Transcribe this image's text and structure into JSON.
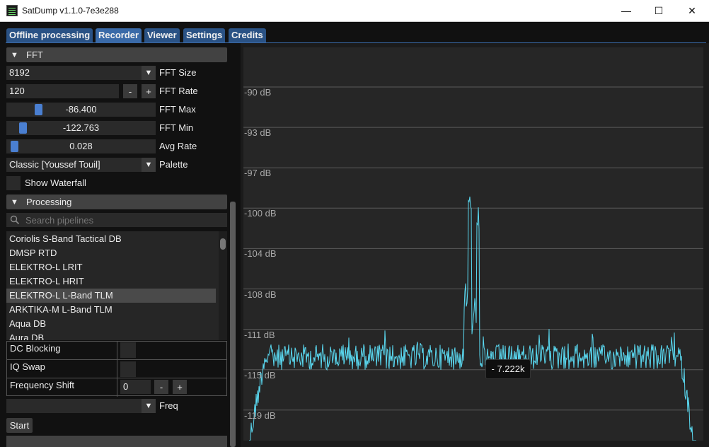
{
  "window": {
    "title": "SatDump v1.1.0-7e3e288",
    "controls": {
      "minimize": "—",
      "maximize": "☐",
      "close": "✕"
    }
  },
  "tabs": [
    {
      "label": "Offline processing",
      "active": false
    },
    {
      "label": "Recorder",
      "active": true
    },
    {
      "label": "Viewer",
      "active": false
    },
    {
      "label": "Settings",
      "active": false
    },
    {
      "label": "Credits",
      "active": false
    }
  ],
  "fft": {
    "header": "FFT",
    "size": {
      "value": "8192",
      "label": "FFT Size"
    },
    "rate": {
      "value": "120",
      "label": "FFT Rate",
      "minus": "-",
      "plus": "+"
    },
    "max": {
      "value": "-86.400",
      "label": "FFT Max",
      "position": 0.2
    },
    "min": {
      "value": "-122.763",
      "label": "FFT Min",
      "position": 0.09
    },
    "avg": {
      "value": "0.028",
      "label": "Avg Rate",
      "position": 0.03
    },
    "palette": {
      "value": "Classic [Youssef Touil]",
      "label": "Palette"
    },
    "waterfall": {
      "label": "Show Waterfall",
      "checked": false
    }
  },
  "processing": {
    "header": "Processing",
    "search_placeholder": "Search pipelines",
    "pipelines": [
      {
        "name": "Coriolis S-Band Tactical DB",
        "selected": false
      },
      {
        "name": "DMSP RTD",
        "selected": false
      },
      {
        "name": "ELEKTRO-L LRIT",
        "selected": false
      },
      {
        "name": "ELEKTRO-L HRIT",
        "selected": false
      },
      {
        "name": "ELEKTRO-L L-Band TLM",
        "selected": true
      },
      {
        "name": "ARKTIKA-M L-Band TLM",
        "selected": false
      },
      {
        "name": "Aqua DB",
        "selected": false
      },
      {
        "name": "Aura DB",
        "selected": false
      }
    ],
    "options": {
      "dc_blocking": "DC Blocking",
      "iq_swap": "IQ Swap",
      "freq_shift": {
        "label": "Frequency Shift",
        "value": "0",
        "minus": "-",
        "plus": "+"
      }
    },
    "freq": {
      "value": "",
      "label": "Freq"
    },
    "start": "Start"
  },
  "plot": {
    "db_labels": [
      "-90 dB",
      "-93 dB",
      "-97 dB",
      "-100 dB",
      "-104 dB",
      "-108 dB",
      "-111 dB",
      "-115 dB",
      "-119 dB"
    ],
    "tooltip": "- 7.222k",
    "trace_color": "#5ad8f0"
  }
}
